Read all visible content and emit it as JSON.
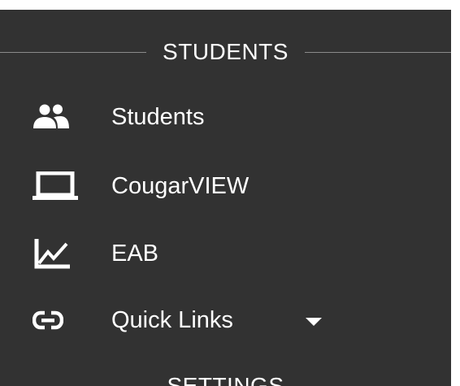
{
  "sections": {
    "students_heading": "STUDENTS",
    "settings_heading": "SETTINGS"
  },
  "nav": {
    "items": [
      {
        "label": "Students",
        "icon": "people-icon"
      },
      {
        "label": "CougarVIEW",
        "icon": "laptop-icon"
      },
      {
        "label": "EAB",
        "icon": "line-chart-icon"
      },
      {
        "label": "Quick Links",
        "icon": "link-icon",
        "has_dropdown": true
      }
    ]
  },
  "colors": {
    "panel_background": "#323232",
    "text": "#ffffff",
    "divider": "#8a8a8a",
    "page_background": "#ffffff"
  }
}
